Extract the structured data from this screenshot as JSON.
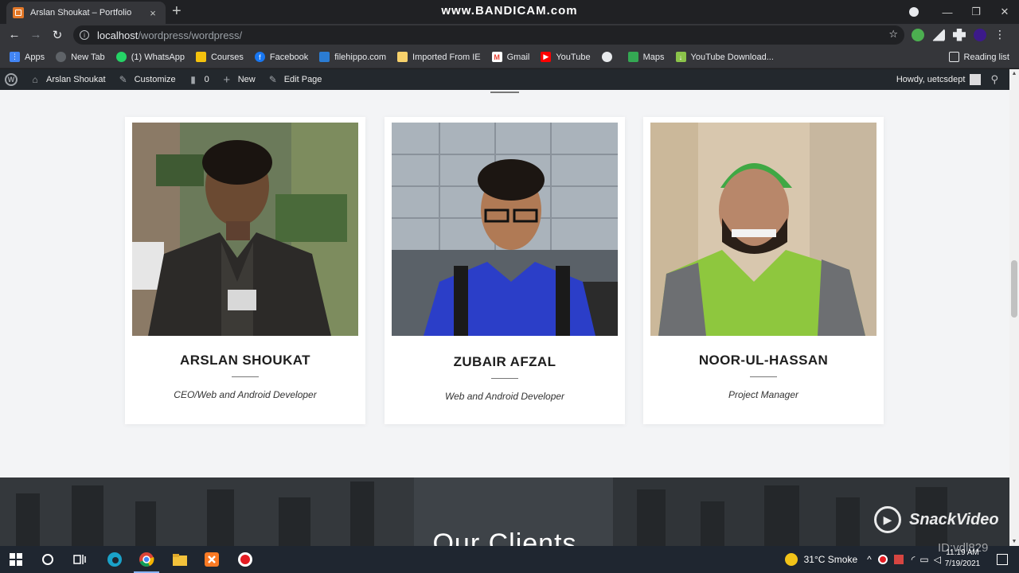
{
  "browser": {
    "tab_title": "Arslan Shoukat – Portfolio",
    "tab_close": "×",
    "new_tab": "+",
    "recorder_watermark": "www.BANDICAM.com",
    "window_controls": [
      "—",
      "❐",
      "✕"
    ],
    "url_host": "localhost",
    "url_path": "/wordpress/wordpress/",
    "bookmarks": [
      {
        "label": "Apps",
        "icon": "apps-grid-icon",
        "color": "#4285f4"
      },
      {
        "label": "New Tab",
        "icon": "globe-icon",
        "color": "#5f6368"
      },
      {
        "label": "(1) WhatsApp",
        "icon": "whatsapp-icon",
        "color": "#25d366"
      },
      {
        "label": "Courses",
        "icon": "courses-icon",
        "color": "#f4c20d"
      },
      {
        "label": "Facebook",
        "icon": "facebook-icon",
        "color": "#1877f2"
      },
      {
        "label": "filehippo.com",
        "icon": "filehippo-icon",
        "color": "#2b7cd3"
      },
      {
        "label": "Imported From IE",
        "icon": "folder-icon",
        "color": "#f7d16b"
      },
      {
        "label": "Gmail",
        "icon": "gmail-icon",
        "color": "#ea4335"
      },
      {
        "label": "YouTube",
        "icon": "youtube-icon",
        "color": "#ff0000"
      },
      {
        "label": "",
        "icon": "globe-icon",
        "color": "#5f6368"
      },
      {
        "label": "Maps",
        "icon": "maps-icon",
        "color": "#34a853"
      },
      {
        "label": "YouTube Download...",
        "icon": "download-icon",
        "color": "#8bc34a"
      }
    ],
    "reading_list": "Reading list"
  },
  "wpbar": {
    "site_name": "Arslan Shoukat",
    "customize": "Customize",
    "comments_count": "0",
    "new": "New",
    "edit_page": "Edit Page",
    "howdy": "Howdy, uetcsdept"
  },
  "team": [
    {
      "name": "ARSLAN SHOUKAT",
      "role": "CEO/Web and Android Developer"
    },
    {
      "name": "ZUBAIR AFZAL",
      "role": "Web and Android Developer"
    },
    {
      "name": "NOOR-UL-HASSAN",
      "role": "Project Manager"
    }
  ],
  "clients_title": "Our Clients",
  "snack_watermark": "SnackVideo",
  "taskbar": {
    "weather": "31°C  Smoke",
    "time": "11:19 AM",
    "date": "7/19/2021",
    "id_watermark": "ID:vdl829"
  }
}
